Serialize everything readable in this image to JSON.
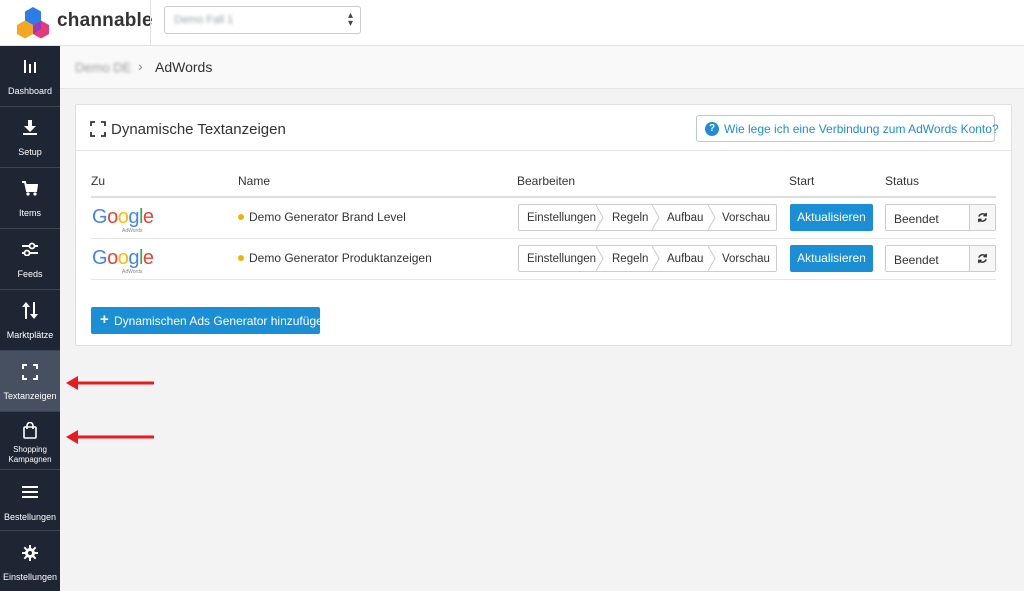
{
  "app": {
    "brand": "channable",
    "project_select_value": "Demo Fall 1"
  },
  "sidebar": {
    "items": [
      {
        "label": "Dashboard",
        "icon": "bar-chart-icon"
      },
      {
        "label": "Setup",
        "icon": "download-icon"
      },
      {
        "label": "Items",
        "icon": "cart-icon"
      },
      {
        "label": "Feeds",
        "icon": "sliders-icon"
      },
      {
        "label": "Marktplätze",
        "icon": "up-down-arrows-icon"
      },
      {
        "label": "Textanzeigen",
        "icon": "expand-corners-icon",
        "active": true
      },
      {
        "label_line1": "Shopping",
        "label_line2": "Kampagnen",
        "icon": "shopping-bag-icon"
      },
      {
        "label": "Bestellungen",
        "icon": "list-icon"
      },
      {
        "label": "Einstellungen",
        "icon": "gear-icon"
      }
    ]
  },
  "breadcrumb": {
    "project": "Demo DE",
    "separator": "›",
    "current": "AdWords"
  },
  "panel": {
    "title": "Dynamische Textanzeigen",
    "help_label": "Wie lege ich eine Verbindung zum AdWords Konto?",
    "columns": {
      "to": "Zu",
      "name": "Name",
      "edit": "Bearbeiten",
      "start": "Start",
      "status": "Status"
    },
    "rows": [
      {
        "logo_text": "Google",
        "logo_sub": "AdWords",
        "name": "Demo Generator Brand Level",
        "steps": [
          "Einstellungen",
          "Regeln",
          "Aufbau",
          "Vorschau"
        ],
        "start_label": "Aktualisieren",
        "status": "Beendet"
      },
      {
        "logo_text": "Google",
        "logo_sub": "AdWords",
        "name": "Demo Generator Produktanzeigen",
        "steps": [
          "Einstellungen",
          "Regeln",
          "Aufbau",
          "Vorschau"
        ],
        "start_label": "Aktualisieren",
        "status": "Beendet"
      }
    ],
    "add_button": "Dynamischen Ads Generator hinzufügen"
  },
  "colors": {
    "sidebar_bg": "#1e2634",
    "sidebar_active": "#465060",
    "primary": "#1a8fd5",
    "annotation_arrow": "#e8191f",
    "status_dot": "#f0b400"
  }
}
